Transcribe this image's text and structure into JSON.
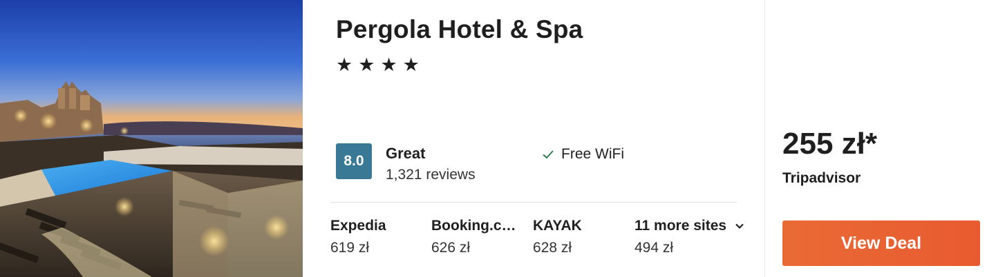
{
  "hotel": {
    "name": "Pergola Hotel & Spa",
    "stars": [
      "★",
      "★",
      "★",
      "★"
    ]
  },
  "rating": {
    "score": "8.0",
    "label": "Great",
    "reviews": "1,321 reviews"
  },
  "amenity": {
    "label": "Free WiFi",
    "icon": "check-icon",
    "color": "#2e7d4f"
  },
  "providers": [
    {
      "name": "Expedia",
      "price": "619 zł"
    },
    {
      "name": "Booking.com",
      "price": "626 zł"
    },
    {
      "name": "KAYAK",
      "price": "628 zł"
    },
    {
      "name": "11 more sites",
      "price": "494 zł",
      "icon": "chevron-down-icon"
    }
  ],
  "deal": {
    "price": "255 zł*",
    "source": "Tripadvisor",
    "button_label": "View Deal",
    "button_color": "#e8612f"
  },
  "colors": {
    "rating_badge": "#3a7996"
  }
}
